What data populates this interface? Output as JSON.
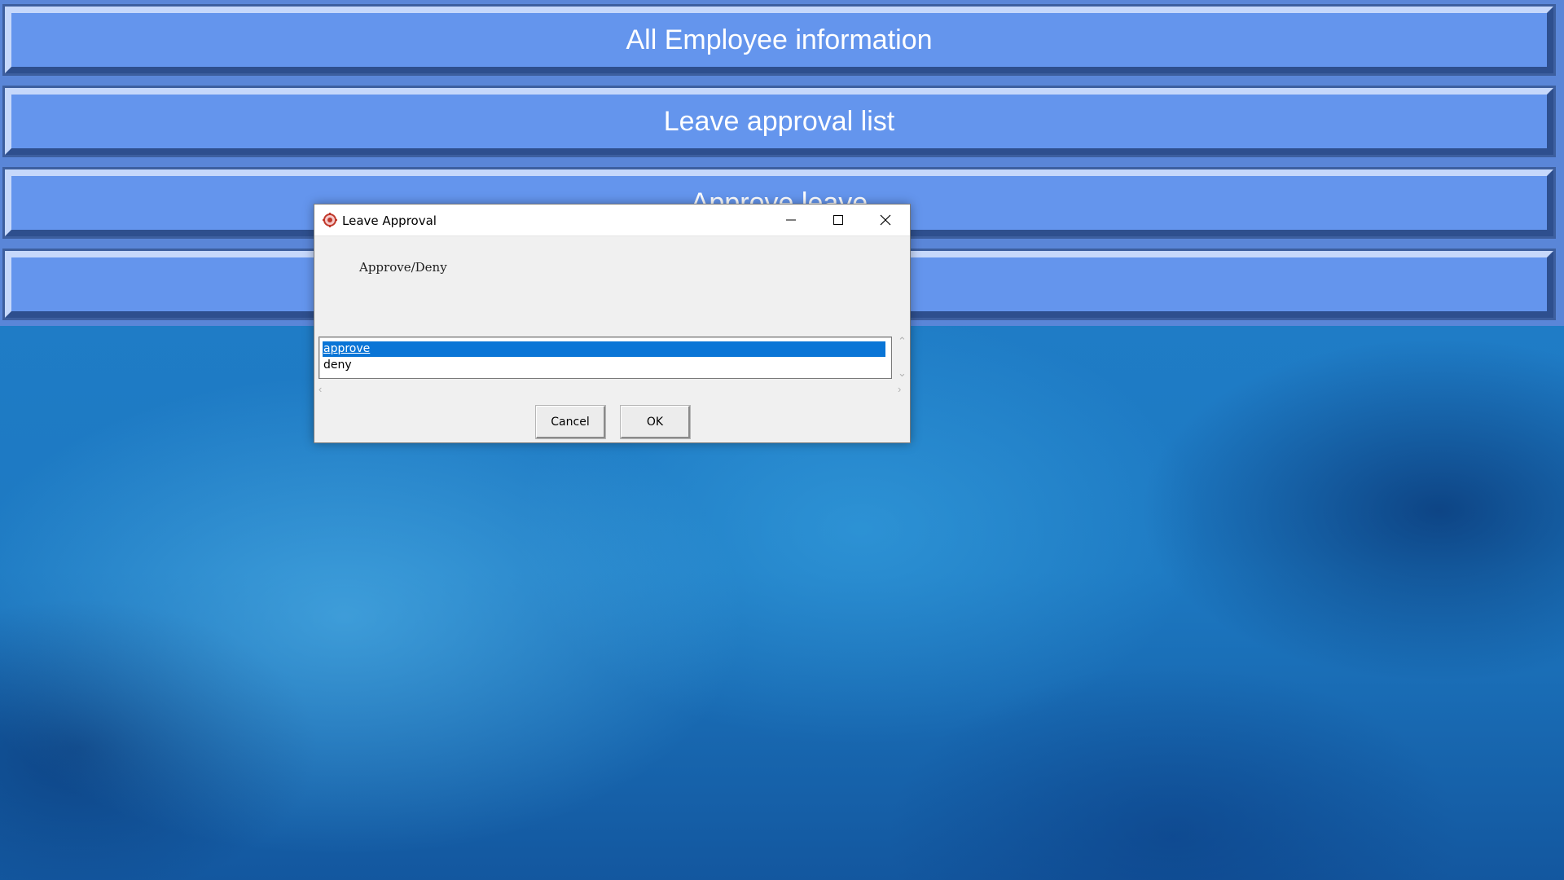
{
  "menu": {
    "items": [
      {
        "label": "All Employee information"
      },
      {
        "label": "Leave approval list"
      },
      {
        "label": "Approve leave"
      },
      {
        "label": ""
      }
    ]
  },
  "dialog": {
    "title": "Leave Approval",
    "prompt": "Approve/Deny",
    "options": [
      "approve",
      "deny"
    ],
    "selected": "approve",
    "cancel_label": "Cancel",
    "ok_label": "OK"
  },
  "colors": {
    "menu_button": "#6495ed",
    "selection": "#0a75d6"
  }
}
